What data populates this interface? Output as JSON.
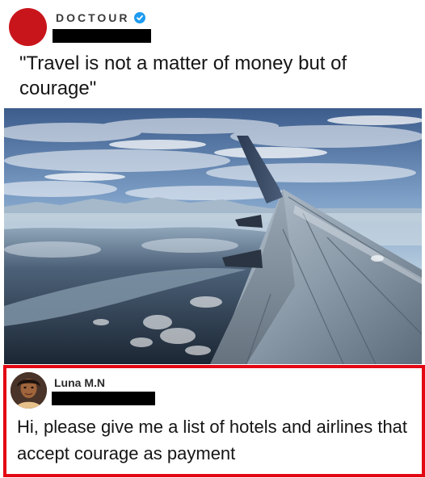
{
  "post": {
    "author_name": "DOCTOUR",
    "avatar_color": "#c8151b",
    "verified_icon": "verified-badge-icon",
    "handle_redacted": true,
    "quote": "\"Travel is not a matter of money but of courage\""
  },
  "photo": {
    "subject": "airplane-wing-over-mountains-image"
  },
  "reply": {
    "author_name": "Luna M.N",
    "handle_redacted": true,
    "text": "Hi, please give me a list of hotels and airlines that accept courage as payment",
    "highlight_color": "#e30613"
  }
}
